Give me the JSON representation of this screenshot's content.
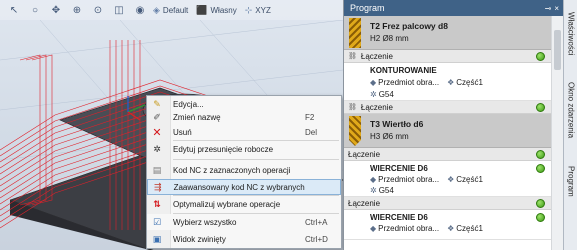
{
  "toolbar": {
    "default_label": "Default",
    "wlasny_label": "Własny",
    "xyz_label": "XYZ"
  },
  "context_menu": {
    "items": [
      {
        "label": "Edycja...",
        "shortcut": "",
        "icon": "edit-icon"
      },
      {
        "label": "Zmień nazwę",
        "shortcut": "F2",
        "icon": "rename-icon"
      },
      {
        "label": "Usuń",
        "shortcut": "Del",
        "icon": "delete-icon"
      },
      {
        "label": "Edytuj przesunięcie robocze",
        "shortcut": "",
        "icon": "work-offset-icon"
      },
      {
        "label": "Kod NC z zaznaczonych operacji",
        "shortcut": "",
        "icon": "nc-code-icon"
      },
      {
        "label": "Zaawansowany kod NC z wybranych",
        "shortcut": "",
        "icon": "advanced-nc-icon"
      },
      {
        "label": "Optymalizuj wybrane operacje",
        "shortcut": "",
        "icon": "optimize-icon"
      },
      {
        "label": "Wybierz wszystko",
        "shortcut": "Ctrl+A",
        "icon": "select-all-icon"
      },
      {
        "label": "Widok zwinięty",
        "shortcut": "Ctrl+D",
        "icon": "collapsed-view-icon"
      }
    ],
    "highlighted_index": 5
  },
  "panel": {
    "title": "Program",
    "pin_glyph": "⊸",
    "close_glyph": "×",
    "tools": [
      {
        "name": "T2 Frez palcowy d8",
        "dim": "H2 Ø8 mm"
      },
      {
        "name": "T3 Wiertło d6",
        "dim": "H3 Ø6 mm"
      }
    ],
    "link_label": "Łączenie",
    "operations": [
      {
        "name": "KONTUROWANIE",
        "part": "Przedmiot obra...",
        "part_id": "Część1",
        "offset": "G54"
      },
      {
        "name": "WIERCENIE D6",
        "part": "Przedmiot obra...",
        "part_id": "Część1",
        "offset": "G54"
      },
      {
        "name": "WIERCENIE D6",
        "part": "Przedmiot obra...",
        "part_id": "Część1"
      }
    ]
  },
  "vertical_tabs": [
    "Właściwości",
    "Okno zdarzenia",
    "Program"
  ],
  "colors": {
    "panel_header": "#3f6287",
    "toolpath": "#e0212a",
    "highlight": "#dbeaf7",
    "ok_status": "#3c9a14"
  }
}
